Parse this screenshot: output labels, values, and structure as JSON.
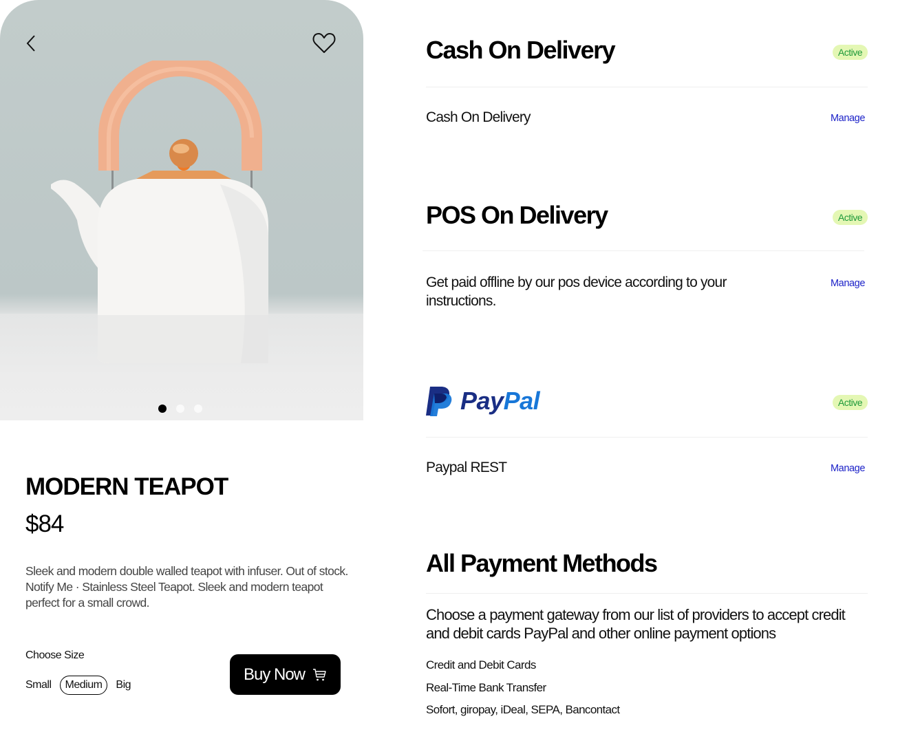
{
  "product": {
    "title": "MODERN TEAPOT",
    "price": "$84",
    "description": "Sleek and modern double walled teapot with infuser. Out of stock. Notify Me · Stainless Steel Teapot. Sleek and modern teapot perfect for a small crowd.",
    "carousel": {
      "total": 3,
      "active_index": 0
    },
    "icons": {
      "back": "chevron-left-icon",
      "favorite": "heart-icon",
      "cart": "cart-icon"
    },
    "size": {
      "label": "Choose Size",
      "options": [
        "Small",
        "Medium",
        "Big"
      ],
      "selected": "Medium"
    },
    "buy_label": "Buy Now"
  },
  "payments": {
    "cash": {
      "heading": "Cash On Delivery",
      "status": "Active",
      "name": "Cash On Delivery",
      "manage_label": "Manage"
    },
    "pos": {
      "heading": "POS On Delivery",
      "status": "Active",
      "description": "Get paid offline by our pos device according to your instructions.",
      "manage_label": "Manage"
    },
    "paypal": {
      "logo_pay": "Pay",
      "logo_pal": "Pal",
      "status": "Active",
      "name": "Paypal REST",
      "manage_label": "Manage"
    },
    "all": {
      "heading": "All Payment Methods",
      "description": "Choose a payment gateway from our list of providers to accept credit and debit cards PayPal and other online payment options",
      "methods": [
        "Credit and Debit Cards",
        "Real-Time Bank Transfer",
        "Sofort, giropay, iDeal, SEPA, Bancontact"
      ]
    }
  },
  "colors": {
    "badge_bg": "#e4f7b4",
    "badge_text": "#1e9a3a",
    "manage_link": "#1c22c8",
    "paypal_dark": "#1a2e84",
    "paypal_light": "#1877d8",
    "handle": "#f0b08e",
    "knob": "#e8782a"
  }
}
